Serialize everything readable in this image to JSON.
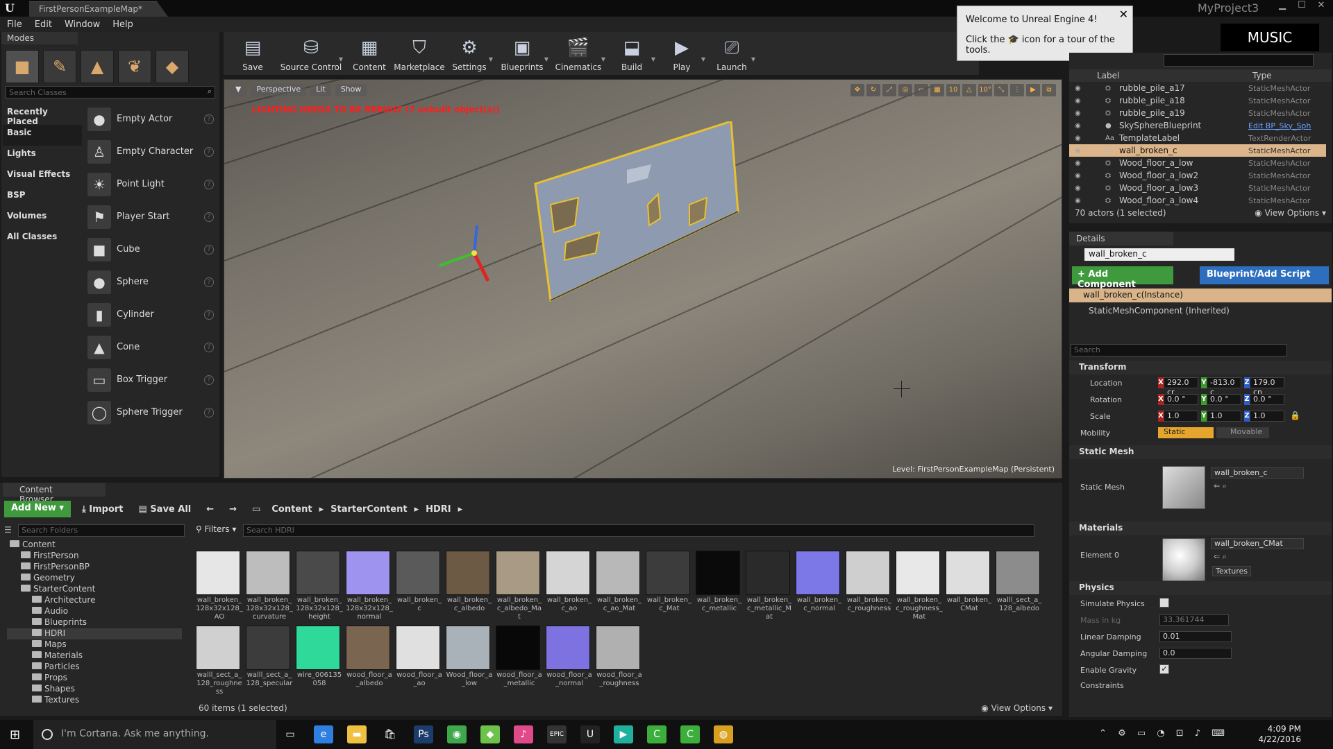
{
  "window": {
    "map_tab": "FirstPersonExampleMap*",
    "project_name": "MyProject3",
    "minimize": "▁",
    "maximize": "☐",
    "close": "✕"
  },
  "menu": [
    "File",
    "Edit",
    "Window",
    "Help"
  ],
  "modes": {
    "tab_label": "Modes",
    "search_placeholder": "Search Classes",
    "categories": [
      "Recently Placed",
      "Basic",
      "Lights",
      "Visual Effects",
      "BSP",
      "Volumes",
      "All Classes"
    ],
    "classes": [
      "Empty Actor",
      "Empty Character",
      "Point Light",
      "Player Start",
      "Cube",
      "Sphere",
      "Cylinder",
      "Cone",
      "Box Trigger",
      "Sphere Trigger"
    ]
  },
  "toolbar": {
    "items": [
      {
        "label": "Save",
        "icon": "save-icon"
      },
      {
        "label": "Source Control",
        "icon": "source-control-icon"
      },
      {
        "label": "Content",
        "icon": "content-icon"
      },
      {
        "label": "Marketplace",
        "icon": "marketplace-icon"
      },
      {
        "label": "Settings",
        "icon": "settings-icon"
      },
      {
        "label": "Blueprints",
        "icon": "blueprints-icon"
      },
      {
        "label": "Cinematics",
        "icon": "cinematics-icon"
      },
      {
        "label": "Build",
        "icon": "build-icon"
      },
      {
        "label": "Play",
        "icon": "play-icon"
      },
      {
        "label": "Launch",
        "icon": "launch-icon"
      }
    ]
  },
  "viewport": {
    "perspective": "Perspective",
    "lit": "Lit",
    "show": "Show",
    "warning": "LIGHTING NEEDS TO BE REBUILT (7 unbuilt object(s))",
    "level": "Level:  FirstPersonExampleMap (Persistent)",
    "scale_value": "10"
  },
  "notification": {
    "title": "Welcome to Unreal Engine 4!",
    "line2_before": "Click the",
    "line2_after": "icon for a tour of the tools."
  },
  "music_button": "MUSIC",
  "outliner": {
    "col_label": "Label",
    "col_type": "Type",
    "rows": [
      {
        "label": "rubble_pile_a17",
        "type": "StaticMeshActor"
      },
      {
        "label": "rubble_pile_a18",
        "type": "StaticMeshActor"
      },
      {
        "label": "rubble_pile_a19",
        "type": "StaticMeshActor"
      },
      {
        "label": "SkySphereBlueprint",
        "type": "Edit BP_Sky_Sph"
      },
      {
        "label": "TemplateLabel",
        "type": "TextRenderActor"
      },
      {
        "label": "wall_broken_c",
        "type": "StaticMeshActor"
      },
      {
        "label": "Wood_floor_a_low",
        "type": "StaticMeshActor"
      },
      {
        "label": "Wood_floor_a_low2",
        "type": "StaticMeshActor"
      },
      {
        "label": "Wood_floor_a_low3",
        "type": "StaticMeshActor"
      },
      {
        "label": "Wood_floor_a_low4",
        "type": "StaticMeshActor"
      }
    ],
    "footer": "70 actors (1 selected)",
    "view_options": "View Options"
  },
  "details": {
    "tab_label": "Details",
    "name": "wall_broken_c",
    "add_component": "+ Add Component",
    "blueprint_script": "Blueprint/Add Script",
    "instance_row": "wall_broken_c(Instance)",
    "inherited_row": "StaticMeshComponent (Inherited)",
    "search_placeholder": "Search",
    "transform_title": "Transform",
    "location_label": "Location",
    "rotation_label": "Rotation",
    "scale_label": "Scale",
    "mobility_label": "Mobility",
    "location": {
      "x": "292.0 cr",
      "y": "-813.0 c",
      "z": "179.0 cn"
    },
    "rotation": {
      "x": "0.0 °",
      "y": "0.0 °",
      "z": "0.0 °"
    },
    "scale": {
      "x": "1.0",
      "y": "1.0",
      "z": "1.0"
    },
    "mobility_static": "Static",
    "mobility_movable": "Movable",
    "static_mesh_title": "Static Mesh",
    "static_mesh_label": "Static Mesh",
    "static_mesh_value": "wall_broken_c",
    "materials_title": "Materials",
    "element_label": "Element 0",
    "material_value": "wall_broken_CMat",
    "textures": "Textures",
    "physics_title": "Physics",
    "simulate_physics": "Simulate Physics",
    "mass_label": "Mass in kg",
    "mass_value": "33.361744",
    "linear_damping_label": "Linear Damping",
    "linear_damping": "0.01",
    "angular_damping_label": "Angular Damping",
    "angular_damping": "0.0",
    "enable_gravity": "Enable Gravity",
    "constraints": "Constraints"
  },
  "content_browser": {
    "tab_label": "Content Browser",
    "add_new": "Add New",
    "import": "Import",
    "save_all": "Save All",
    "breadcrumb": [
      "Content",
      "StarterContent",
      "HDRI"
    ],
    "folder_search": "Search Folders",
    "filters": "Filters",
    "asset_search": "Search HDRI",
    "tree": [
      {
        "label": "Content",
        "depth": 0
      },
      {
        "label": "FirstPerson",
        "depth": 1
      },
      {
        "label": "FirstPersonBP",
        "depth": 1
      },
      {
        "label": "Geometry",
        "depth": 1
      },
      {
        "label": "StarterContent",
        "depth": 1
      },
      {
        "label": "Architecture",
        "depth": 2
      },
      {
        "label": "Audio",
        "depth": 2
      },
      {
        "label": "Blueprints",
        "depth": 2
      },
      {
        "label": "HDRI",
        "depth": 2
      },
      {
        "label": "Maps",
        "depth": 2
      },
      {
        "label": "Materials",
        "depth": 2
      },
      {
        "label": "Particles",
        "depth": 2
      },
      {
        "label": "Props",
        "depth": 2
      },
      {
        "label": "Shapes",
        "depth": 2
      },
      {
        "label": "Textures",
        "depth": 2
      }
    ],
    "assets_row1": [
      {
        "name": "wall_broken_128x32x128_AO",
        "color": "#e6e6e6"
      },
      {
        "name": "wall_broken_128x32x128_curvature",
        "color": "#bdbdbd"
      },
      {
        "name": "wall_broken_128x32x128_height",
        "color": "#4a4a4a"
      },
      {
        "name": "wall_broken_128x32x128_normal",
        "color": "#9f93f0"
      },
      {
        "name": "wall_broken_c",
        "color": "#5a5a5a"
      },
      {
        "name": "wall_broken_c_albedo",
        "color": "#6d5a45"
      },
      {
        "name": "wall_broken_c_albedo_Mat",
        "color": "#a89a84"
      },
      {
        "name": "wall_broken_c_ao",
        "color": "#d5d5d5"
      },
      {
        "name": "wall_broken_c_ao_Mat",
        "color": "#b8b8b8"
      },
      {
        "name": "wall_broken_c_Mat",
        "color": "#3c3c3c"
      },
      {
        "name": "wall_broken_c_metallic",
        "color": "#0a0a0a"
      },
      {
        "name": "wall_broken_c_metallic_Mat",
        "color": "#2a2a2a"
      },
      {
        "name": "wall_broken_c_normal",
        "color": "#7d78e8"
      },
      {
        "name": "wall_broken_c_roughness",
        "color": "#cfcfcf"
      },
      {
        "name": "wall_broken_c_roughness_Mat",
        "color": "#e8e8e8"
      },
      {
        "name": "wall_broken_CMat",
        "color": "#dedede"
      },
      {
        "name": "walll_sect_a_128_albedo",
        "color": "#8c8c8c"
      }
    ],
    "assets_row2": [
      {
        "name": "walll_sect_a_128_roughness",
        "color": "#d0d0d0"
      },
      {
        "name": "walll_sect_a_128_specular",
        "color": "#3c3c3c"
      },
      {
        "name": "wire_006135058",
        "color": "#2fd99a"
      },
      {
        "name": "wood_floor_a_albedo",
        "color": "#7a6650"
      },
      {
        "name": "wood_floor_a_ao",
        "color": "#e0e0e0"
      },
      {
        "name": "Wood_floor_a_low",
        "color": "#a8b2b8"
      },
      {
        "name": "wood_floor_a_metallic",
        "color": "#080808"
      },
      {
        "name": "wood_floor_a_normal",
        "color": "#7d72e0"
      },
      {
        "name": "wood_floor_a_roughness",
        "color": "#b0b0b0"
      }
    ],
    "footer": "60 items (1 selected)",
    "view_options": "View Options"
  },
  "taskbar": {
    "cortana": "I'm Cortana. Ask me anything.",
    "time": "4:09 PM",
    "date": "4/22/2016",
    "apps": [
      "task-view",
      "edge",
      "file-explorer",
      "store",
      "photoshop",
      "app-green",
      "app-android",
      "itunes",
      "epic-launcher",
      "unreal-engine",
      "app-teal",
      "camtasia",
      "camtasia-2",
      "chrome"
    ]
  }
}
